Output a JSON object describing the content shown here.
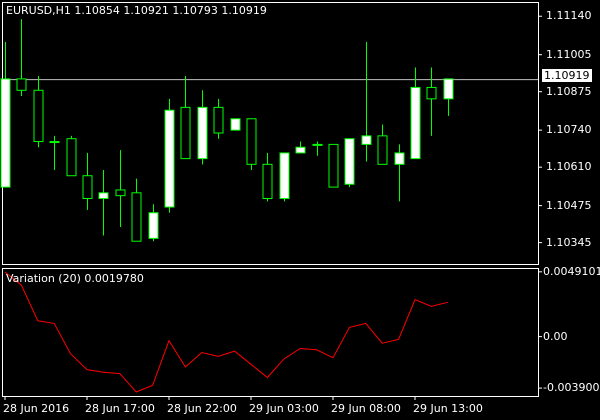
{
  "main_title": "EURUSD,H1  1.10854 1.10921 1.10793 1.10919",
  "indicator_title": "Variation (20) 0.0019780",
  "current_price": "1.10919",
  "colors": {
    "background": "#000000",
    "axis": "#ffffff",
    "bull_body": "#ffffff",
    "bear_body": "#000000",
    "wick": "#00ff00",
    "indicator_line": "#ff0000",
    "price_line": "#c0c0c0"
  },
  "chart_data": [
    {
      "type": "candlestick",
      "title": "EURUSD,H1  1.10854 1.10921 1.10793 1.10919",
      "xlabel": "",
      "ylabel": "",
      "ylim": [
        1.1027,
        1.1119
      ],
      "y_ticks": [
        "1.11140",
        "1.11005",
        "1.10875",
        "1.10740",
        "1.10610",
        "1.10475",
        "1.10345"
      ],
      "x_ticks": [
        "28 Jun 2016",
        "28 Jun 17:00",
        "28 Jun 22:00",
        "29 Jun 03:00",
        "29 Jun 08:00",
        "29 Jun 13:00"
      ],
      "x_tick_index": [
        0,
        5,
        10,
        15,
        20,
        25
      ],
      "candles": [
        {
          "o": 1.1054,
          "h": 1.1105,
          "l": 1.1054,
          "c": 1.1092
        },
        {
          "o": 1.1092,
          "h": 1.1113,
          "l": 1.1086,
          "c": 1.1088
        },
        {
          "o": 1.1088,
          "h": 1.1093,
          "l": 1.1068,
          "c": 1.107
        },
        {
          "o": 1.107,
          "h": 1.1072,
          "l": 1.106,
          "c": 1.107
        },
        {
          "o": 1.1071,
          "h": 1.1072,
          "l": 1.1058,
          "c": 1.1058
        },
        {
          "o": 1.1058,
          "h": 1.1066,
          "l": 1.1046,
          "c": 1.105
        },
        {
          "o": 1.105,
          "h": 1.106,
          "l": 1.1037,
          "c": 1.1052
        },
        {
          "o": 1.1053,
          "h": 1.1067,
          "l": 1.104,
          "c": 1.1051
        },
        {
          "o": 1.1052,
          "h": 1.1057,
          "l": 1.1035,
          "c": 1.1035
        },
        {
          "o": 1.1036,
          "h": 1.1048,
          "l": 1.1035,
          "c": 1.1045
        },
        {
          "o": 1.1047,
          "h": 1.1085,
          "l": 1.1045,
          "c": 1.1081
        },
        {
          "o": 1.1082,
          "h": 1.1093,
          "l": 1.1064,
          "c": 1.1064
        },
        {
          "o": 1.1064,
          "h": 1.1088,
          "l": 1.1062,
          "c": 1.1082
        },
        {
          "o": 1.1082,
          "h": 1.1085,
          "l": 1.1071,
          "c": 1.1073
        },
        {
          "o": 1.1074,
          "h": 1.1078,
          "l": 1.1074,
          "c": 1.1078
        },
        {
          "o": 1.1078,
          "h": 1.1078,
          "l": 1.106,
          "c": 1.1062
        },
        {
          "o": 1.1062,
          "h": 1.1066,
          "l": 1.1049,
          "c": 1.105
        },
        {
          "o": 1.105,
          "h": 1.1066,
          "l": 1.1049,
          "c": 1.1066
        },
        {
          "o": 1.1066,
          "h": 1.107,
          "l": 1.1066,
          "c": 1.1068
        },
        {
          "o": 1.1069,
          "h": 1.107,
          "l": 1.1065,
          "c": 1.1069
        },
        {
          "o": 1.1069,
          "h": 1.1069,
          "l": 1.1054,
          "c": 1.1054
        },
        {
          "o": 1.1055,
          "h": 1.1071,
          "l": 1.1054,
          "c": 1.1071
        },
        {
          "o": 1.1069,
          "h": 1.1105,
          "l": 1.1063,
          "c": 1.1072
        },
        {
          "o": 1.1072,
          "h": 1.1076,
          "l": 1.1062,
          "c": 1.1062
        },
        {
          "o": 1.1062,
          "h": 1.1069,
          "l": 1.1049,
          "c": 1.1066
        },
        {
          "o": 1.1064,
          "h": 1.1096,
          "l": 1.1064,
          "c": 1.1089
        },
        {
          "o": 1.1089,
          "h": 1.1096,
          "l": 1.1072,
          "c": 1.1085
        },
        {
          "o": 1.1085,
          "h": 1.1092,
          "l": 1.1079,
          "c": 1.1092
        }
      ]
    },
    {
      "type": "line",
      "title": "Variation (20) 0.0019780",
      "xlabel": "",
      "ylabel": "",
      "ylim": [
        -0.0045,
        0.0052
      ],
      "y_ticks": [
        "0.0049101",
        "0.00",
        "-0.003900"
      ],
      "y_tick_values": [
        0.0049101,
        0.0,
        -0.0039
      ],
      "series": [
        {
          "values": [
            0.0049,
            0.0039,
            0.0012,
            0.001,
            -0.0013,
            -0.0025,
            -0.0027,
            -0.0028,
            -0.0042,
            -0.0037,
            -0.0003,
            -0.0023,
            -0.0012,
            -0.0015,
            -0.0011,
            -0.0021,
            -0.0031,
            -0.0017,
            -0.0009,
            -0.001,
            -0.0016,
            0.0007,
            0.001,
            -0.0005,
            -0.0002,
            0.0028,
            0.0023,
            0.0026
          ]
        }
      ]
    }
  ]
}
